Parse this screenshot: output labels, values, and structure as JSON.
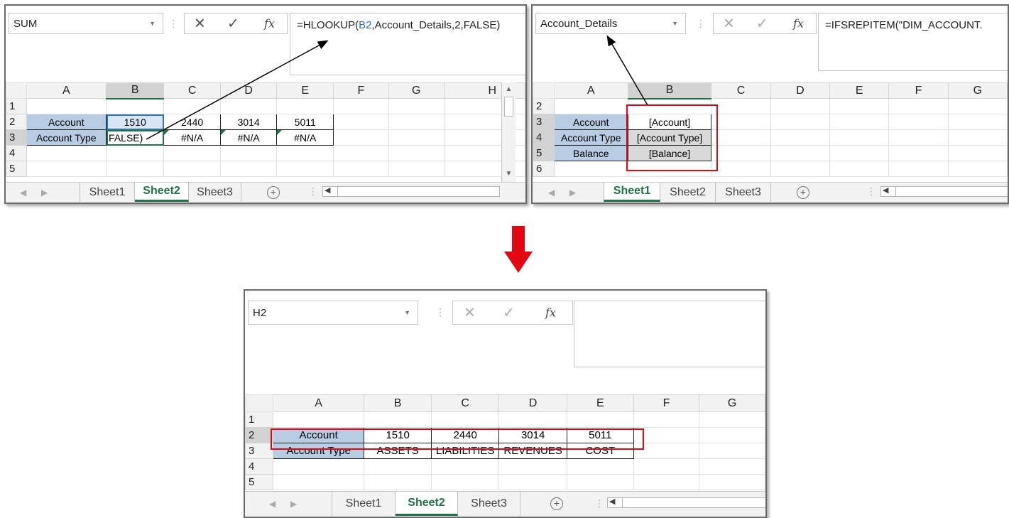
{
  "panel1": {
    "name_box": "SUM",
    "formula_parts": [
      "=HLOOKUP(",
      "B2",
      ",Account_Details,2,FALSE)"
    ],
    "columns": [
      "A",
      "B",
      "C",
      "D",
      "E",
      "F",
      "G",
      "H"
    ],
    "rows": [
      "1",
      "2",
      "3",
      "4",
      "5"
    ],
    "row2": [
      "Account",
      "1510",
      "2440",
      "3014",
      "5011"
    ],
    "row3": [
      "Account Type",
      "FALSE)",
      "#N/A",
      "#N/A",
      "#N/A"
    ],
    "tabs": [
      "Sheet1",
      "Sheet2",
      "Sheet3"
    ],
    "active_tab": "Sheet2"
  },
  "panel2": {
    "name_box": "Account_Details",
    "formula": "=IFSREPITEM(\"DIM_ACCOUNT.",
    "columns": [
      "A",
      "B",
      "C",
      "D",
      "E",
      "F",
      "G"
    ],
    "rows": [
      "2",
      "3",
      "4",
      "5",
      "6"
    ],
    "labels": [
      "Account",
      "Account Type",
      "Balance"
    ],
    "values": [
      "[Account]",
      "[Account Type]",
      "[Balance]"
    ],
    "tabs": [
      "Sheet1",
      "Sheet2",
      "Sheet3"
    ],
    "active_tab": "Sheet1"
  },
  "panel3": {
    "name_box": "H2",
    "formula": "",
    "columns": [
      "A",
      "B",
      "C",
      "D",
      "E",
      "F",
      "G"
    ],
    "rows": [
      "1",
      "2",
      "3",
      "4",
      "5"
    ],
    "row2": [
      "Account",
      "1510",
      "2440",
      "3014",
      "5011"
    ],
    "row3": [
      "Account Type",
      "ASSETS",
      "LIABILITIES",
      "REVENUES",
      "COST"
    ],
    "tabs": [
      "Sheet1",
      "Sheet2",
      "Sheet3"
    ],
    "active_tab": "Sheet2"
  },
  "colors": {
    "label_fill": "#b8cce4",
    "excel_green": "#217346",
    "highlight_red": "#e30613",
    "arrow_red": "#e30613"
  },
  "icons": [
    "cancel-icon",
    "enter-check-icon",
    "fx-icon",
    "dropdown-icon",
    "new-sheet-plus-icon",
    "down-arrow-icon"
  ]
}
